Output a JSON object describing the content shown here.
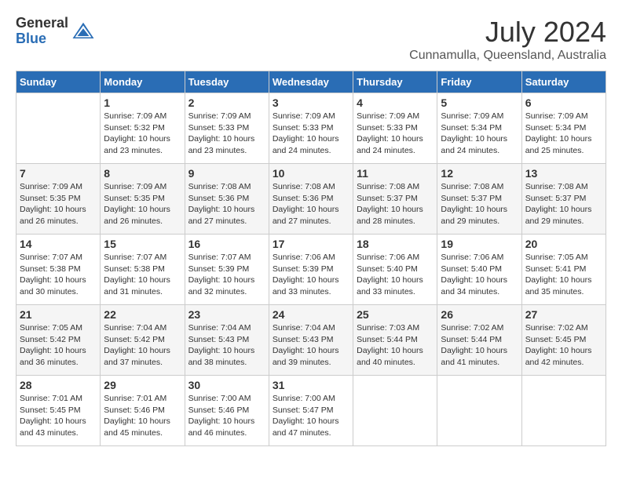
{
  "header": {
    "logo_general": "General",
    "logo_blue": "Blue",
    "month_title": "July 2024",
    "location": "Cunnamulla, Queensland, Australia"
  },
  "weekdays": [
    "Sunday",
    "Monday",
    "Tuesday",
    "Wednesday",
    "Thursday",
    "Friday",
    "Saturday"
  ],
  "weeks": [
    [
      {
        "day": "",
        "info": ""
      },
      {
        "day": "1",
        "info": "Sunrise: 7:09 AM\nSunset: 5:32 PM\nDaylight: 10 hours\nand 23 minutes."
      },
      {
        "day": "2",
        "info": "Sunrise: 7:09 AM\nSunset: 5:33 PM\nDaylight: 10 hours\nand 23 minutes."
      },
      {
        "day": "3",
        "info": "Sunrise: 7:09 AM\nSunset: 5:33 PM\nDaylight: 10 hours\nand 24 minutes."
      },
      {
        "day": "4",
        "info": "Sunrise: 7:09 AM\nSunset: 5:33 PM\nDaylight: 10 hours\nand 24 minutes."
      },
      {
        "day": "5",
        "info": "Sunrise: 7:09 AM\nSunset: 5:34 PM\nDaylight: 10 hours\nand 24 minutes."
      },
      {
        "day": "6",
        "info": "Sunrise: 7:09 AM\nSunset: 5:34 PM\nDaylight: 10 hours\nand 25 minutes."
      }
    ],
    [
      {
        "day": "7",
        "info": "Sunrise: 7:09 AM\nSunset: 5:35 PM\nDaylight: 10 hours\nand 26 minutes."
      },
      {
        "day": "8",
        "info": "Sunrise: 7:09 AM\nSunset: 5:35 PM\nDaylight: 10 hours\nand 26 minutes."
      },
      {
        "day": "9",
        "info": "Sunrise: 7:08 AM\nSunset: 5:36 PM\nDaylight: 10 hours\nand 27 minutes."
      },
      {
        "day": "10",
        "info": "Sunrise: 7:08 AM\nSunset: 5:36 PM\nDaylight: 10 hours\nand 27 minutes."
      },
      {
        "day": "11",
        "info": "Sunrise: 7:08 AM\nSunset: 5:37 PM\nDaylight: 10 hours\nand 28 minutes."
      },
      {
        "day": "12",
        "info": "Sunrise: 7:08 AM\nSunset: 5:37 PM\nDaylight: 10 hours\nand 29 minutes."
      },
      {
        "day": "13",
        "info": "Sunrise: 7:08 AM\nSunset: 5:37 PM\nDaylight: 10 hours\nand 29 minutes."
      }
    ],
    [
      {
        "day": "14",
        "info": "Sunrise: 7:07 AM\nSunset: 5:38 PM\nDaylight: 10 hours\nand 30 minutes."
      },
      {
        "day": "15",
        "info": "Sunrise: 7:07 AM\nSunset: 5:38 PM\nDaylight: 10 hours\nand 31 minutes."
      },
      {
        "day": "16",
        "info": "Sunrise: 7:07 AM\nSunset: 5:39 PM\nDaylight: 10 hours\nand 32 minutes."
      },
      {
        "day": "17",
        "info": "Sunrise: 7:06 AM\nSunset: 5:39 PM\nDaylight: 10 hours\nand 33 minutes."
      },
      {
        "day": "18",
        "info": "Sunrise: 7:06 AM\nSunset: 5:40 PM\nDaylight: 10 hours\nand 33 minutes."
      },
      {
        "day": "19",
        "info": "Sunrise: 7:06 AM\nSunset: 5:40 PM\nDaylight: 10 hours\nand 34 minutes."
      },
      {
        "day": "20",
        "info": "Sunrise: 7:05 AM\nSunset: 5:41 PM\nDaylight: 10 hours\nand 35 minutes."
      }
    ],
    [
      {
        "day": "21",
        "info": "Sunrise: 7:05 AM\nSunset: 5:42 PM\nDaylight: 10 hours\nand 36 minutes."
      },
      {
        "day": "22",
        "info": "Sunrise: 7:04 AM\nSunset: 5:42 PM\nDaylight: 10 hours\nand 37 minutes."
      },
      {
        "day": "23",
        "info": "Sunrise: 7:04 AM\nSunset: 5:43 PM\nDaylight: 10 hours\nand 38 minutes."
      },
      {
        "day": "24",
        "info": "Sunrise: 7:04 AM\nSunset: 5:43 PM\nDaylight: 10 hours\nand 39 minutes."
      },
      {
        "day": "25",
        "info": "Sunrise: 7:03 AM\nSunset: 5:44 PM\nDaylight: 10 hours\nand 40 minutes."
      },
      {
        "day": "26",
        "info": "Sunrise: 7:02 AM\nSunset: 5:44 PM\nDaylight: 10 hours\nand 41 minutes."
      },
      {
        "day": "27",
        "info": "Sunrise: 7:02 AM\nSunset: 5:45 PM\nDaylight: 10 hours\nand 42 minutes."
      }
    ],
    [
      {
        "day": "28",
        "info": "Sunrise: 7:01 AM\nSunset: 5:45 PM\nDaylight: 10 hours\nand 43 minutes."
      },
      {
        "day": "29",
        "info": "Sunrise: 7:01 AM\nSunset: 5:46 PM\nDaylight: 10 hours\nand 45 minutes."
      },
      {
        "day": "30",
        "info": "Sunrise: 7:00 AM\nSunset: 5:46 PM\nDaylight: 10 hours\nand 46 minutes."
      },
      {
        "day": "31",
        "info": "Sunrise: 7:00 AM\nSunset: 5:47 PM\nDaylight: 10 hours\nand 47 minutes."
      },
      {
        "day": "",
        "info": ""
      },
      {
        "day": "",
        "info": ""
      },
      {
        "day": "",
        "info": ""
      }
    ]
  ]
}
